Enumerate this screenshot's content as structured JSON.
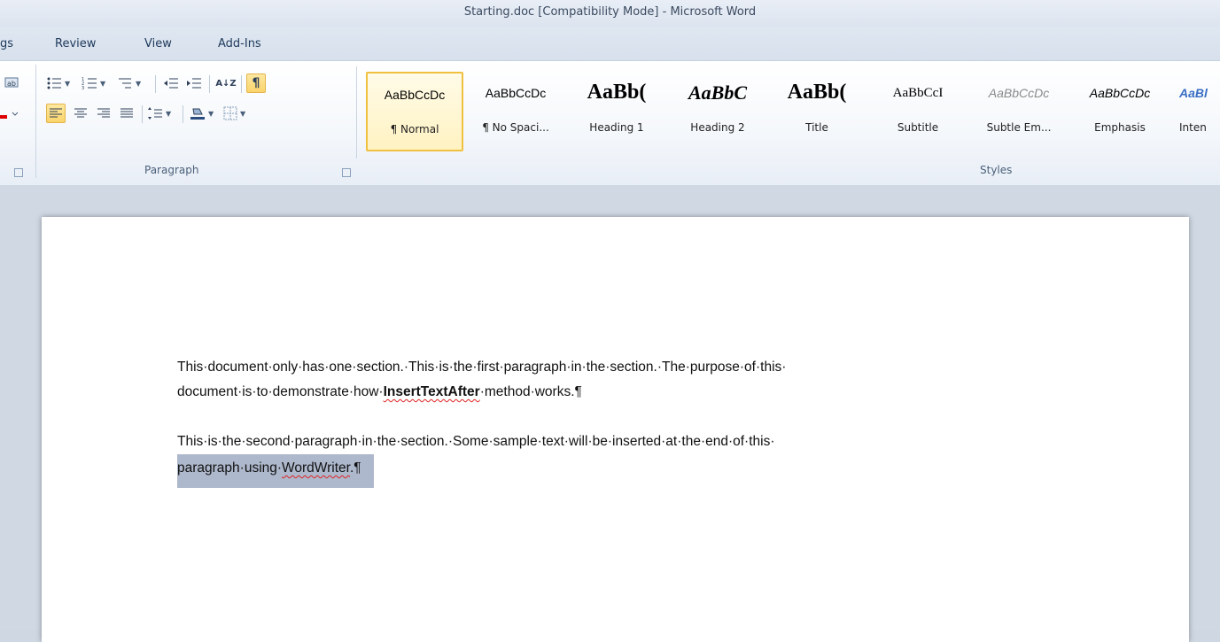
{
  "window": {
    "title": "Starting.doc [Compatibility Mode]  -  Microsoft Word"
  },
  "tabs": [
    {
      "label": "gs"
    },
    {
      "label": "Review"
    },
    {
      "label": "View"
    },
    {
      "label": "Add-Ins"
    }
  ],
  "ribbon": {
    "paragraph_group_label": "Paragraph",
    "styles_group_label": "Styles",
    "sort_glyph": "A↓Z",
    "pilcrow": "¶"
  },
  "styles": [
    {
      "sample": "AaBbCcDc",
      "name": "¶ Normal"
    },
    {
      "sample": "AaBbCcDc",
      "name": "¶ No Spaci..."
    },
    {
      "sample": "AaBb(",
      "name": "Heading 1"
    },
    {
      "sample": "AaBbC",
      "name": "Heading 2"
    },
    {
      "sample": "AaBb(",
      "name": "Title"
    },
    {
      "sample": "AaBbCcI",
      "name": "Subtitle"
    },
    {
      "sample": "AaBbCcDc",
      "name": "Subtle Em..."
    },
    {
      "sample": "AaBbCcDc",
      "name": "Emphasis"
    },
    {
      "sample": "AaBl",
      "name": "Inten"
    }
  ],
  "document": {
    "para1_line1": "This·document·only·has·one·section.·This·is·the·first·paragraph·in·the·section.·The·purpose·of·this·",
    "para1_line2_pre": "document·is·to·demonstrate·how·",
    "para1_bold": "InsertTextAfter",
    "para1_line2_post": "·method·works.¶",
    "para2_line1": "This·is·the·second·paragraph·in·the·section.·Some·sample·text·will·be·inserted·at·the·end·of·this·",
    "para2_line2_pre": "paragraph·using·",
    "para2_squiggle": "WordWriter",
    "para2_line2_post": ".¶"
  },
  "colors": {
    "accent": "#f0c040",
    "selection": "#aeb8cc",
    "ribbon_text": "#1e395b"
  }
}
